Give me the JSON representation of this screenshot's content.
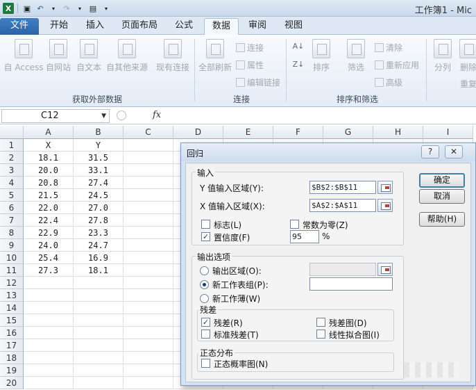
{
  "window": {
    "title": "工作簿1 - Mic"
  },
  "ribbon": {
    "tabs": [
      "文件",
      "开始",
      "插入",
      "页面布局",
      "公式",
      "数据",
      "审阅",
      "视图"
    ],
    "active_tab": "数据",
    "external_data": {
      "buttons": [
        "自 Access",
        "自网站",
        "自文本",
        "自其他来源",
        "现有连接"
      ],
      "label": "获取外部数据"
    },
    "connections": {
      "refresh_all": "全部刷新",
      "commands": [
        "连接",
        "属性",
        "编辑链接"
      ],
      "label": "连接"
    },
    "sort_filter": {
      "sort": "排序",
      "filter": "筛选",
      "commands": [
        "清除",
        "重新应用",
        "高级"
      ],
      "label": "排序和筛选"
    },
    "data_tools": {
      "split": "分列",
      "remove_dup": "删除",
      "dup_second": "重复"
    }
  },
  "formula_bar": {
    "name_box": "C12",
    "fx": "fx"
  },
  "sheet": {
    "columns": [
      "A",
      "B",
      "C",
      "D",
      "E",
      "F",
      "G",
      "H",
      "I"
    ],
    "rows": [
      "1",
      "2",
      "3",
      "4",
      "5",
      "6",
      "7",
      "8",
      "9",
      "10",
      "11",
      "12",
      "13",
      "14",
      "15",
      "16",
      "17",
      "18",
      "19",
      "20"
    ],
    "headers": [
      "X",
      "Y"
    ],
    "data": [
      [
        "18.1",
        "31.5"
      ],
      [
        "20.0",
        "33.1"
      ],
      [
        "20.8",
        "27.4"
      ],
      [
        "21.5",
        "24.5"
      ],
      [
        "22.0",
        "27.0"
      ],
      [
        "22.4",
        "27.8"
      ],
      [
        "22.9",
        "23.3"
      ],
      [
        "24.0",
        "24.7"
      ],
      [
        "25.4",
        "16.9"
      ],
      [
        "27.3",
        "18.1"
      ]
    ]
  },
  "dialog": {
    "title": "回归",
    "help_glyph": "?",
    "close_glyph": "✕",
    "input": {
      "legend": "输入",
      "y_label": "Y 值输入区域(Y):",
      "y_value": "$B$2:$B$11",
      "x_label": "X 值输入区域(X):",
      "x_value": "$A$2:$A$11",
      "labels_check": "标志(L)",
      "const_zero_check": "常数为零(Z)",
      "confidence_check": "置信度(F)",
      "confidence_value": "95",
      "percent": "%"
    },
    "output": {
      "legend": "输出选项",
      "output_range": "输出区域(O):",
      "new_sheet": "新工作表组(P):",
      "new_workbook": "新工作薄(W)"
    },
    "residuals": {
      "legend": "残差",
      "residuals": "残差(R)",
      "std_residuals": "标准残差(T)",
      "residual_plot": "残差图(D)",
      "line_fit_plot": "线性拟合图(I)"
    },
    "normal": {
      "legend": "正态分布",
      "probability_plot": "正态概率图(N)"
    },
    "buttons": {
      "ok": "确定",
      "cancel": "取消",
      "help": "帮助(H)"
    },
    "checkmark": "✓"
  }
}
